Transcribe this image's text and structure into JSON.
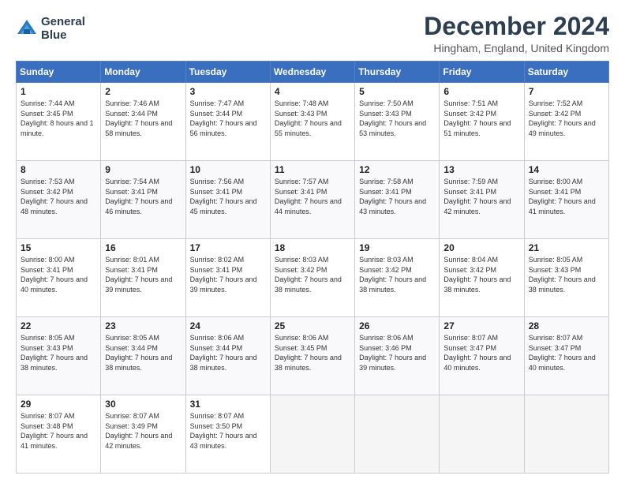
{
  "logo": {
    "line1": "General",
    "line2": "Blue"
  },
  "title": "December 2024",
  "subtitle": "Hingham, England, United Kingdom",
  "headers": [
    "Sunday",
    "Monday",
    "Tuesday",
    "Wednesday",
    "Thursday",
    "Friday",
    "Saturday"
  ],
  "weeks": [
    [
      {
        "day": "1",
        "rise": "Sunrise: 7:44 AM",
        "set": "Sunset: 3:45 PM",
        "daylight": "Daylight: 8 hours and 1 minute."
      },
      {
        "day": "2",
        "rise": "Sunrise: 7:46 AM",
        "set": "Sunset: 3:44 PM",
        "daylight": "Daylight: 7 hours and 58 minutes."
      },
      {
        "day": "3",
        "rise": "Sunrise: 7:47 AM",
        "set": "Sunset: 3:44 PM",
        "daylight": "Daylight: 7 hours and 56 minutes."
      },
      {
        "day": "4",
        "rise": "Sunrise: 7:48 AM",
        "set": "Sunset: 3:43 PM",
        "daylight": "Daylight: 7 hours and 55 minutes."
      },
      {
        "day": "5",
        "rise": "Sunrise: 7:50 AM",
        "set": "Sunset: 3:43 PM",
        "daylight": "Daylight: 7 hours and 53 minutes."
      },
      {
        "day": "6",
        "rise": "Sunrise: 7:51 AM",
        "set": "Sunset: 3:42 PM",
        "daylight": "Daylight: 7 hours and 51 minutes."
      },
      {
        "day": "7",
        "rise": "Sunrise: 7:52 AM",
        "set": "Sunset: 3:42 PM",
        "daylight": "Daylight: 7 hours and 49 minutes."
      }
    ],
    [
      {
        "day": "8",
        "rise": "Sunrise: 7:53 AM",
        "set": "Sunset: 3:42 PM",
        "daylight": "Daylight: 7 hours and 48 minutes."
      },
      {
        "day": "9",
        "rise": "Sunrise: 7:54 AM",
        "set": "Sunset: 3:41 PM",
        "daylight": "Daylight: 7 hours and 46 minutes."
      },
      {
        "day": "10",
        "rise": "Sunrise: 7:56 AM",
        "set": "Sunset: 3:41 PM",
        "daylight": "Daylight: 7 hours and 45 minutes."
      },
      {
        "day": "11",
        "rise": "Sunrise: 7:57 AM",
        "set": "Sunset: 3:41 PM",
        "daylight": "Daylight: 7 hours and 44 minutes."
      },
      {
        "day": "12",
        "rise": "Sunrise: 7:58 AM",
        "set": "Sunset: 3:41 PM",
        "daylight": "Daylight: 7 hours and 43 minutes."
      },
      {
        "day": "13",
        "rise": "Sunrise: 7:59 AM",
        "set": "Sunset: 3:41 PM",
        "daylight": "Daylight: 7 hours and 42 minutes."
      },
      {
        "day": "14",
        "rise": "Sunrise: 8:00 AM",
        "set": "Sunset: 3:41 PM",
        "daylight": "Daylight: 7 hours and 41 minutes."
      }
    ],
    [
      {
        "day": "15",
        "rise": "Sunrise: 8:00 AM",
        "set": "Sunset: 3:41 PM",
        "daylight": "Daylight: 7 hours and 40 minutes."
      },
      {
        "day": "16",
        "rise": "Sunrise: 8:01 AM",
        "set": "Sunset: 3:41 PM",
        "daylight": "Daylight: 7 hours and 39 minutes."
      },
      {
        "day": "17",
        "rise": "Sunrise: 8:02 AM",
        "set": "Sunset: 3:41 PM",
        "daylight": "Daylight: 7 hours and 39 minutes."
      },
      {
        "day": "18",
        "rise": "Sunrise: 8:03 AM",
        "set": "Sunset: 3:42 PM",
        "daylight": "Daylight: 7 hours and 38 minutes."
      },
      {
        "day": "19",
        "rise": "Sunrise: 8:03 AM",
        "set": "Sunset: 3:42 PM",
        "daylight": "Daylight: 7 hours and 38 minutes."
      },
      {
        "day": "20",
        "rise": "Sunrise: 8:04 AM",
        "set": "Sunset: 3:42 PM",
        "daylight": "Daylight: 7 hours and 38 minutes."
      },
      {
        "day": "21",
        "rise": "Sunrise: 8:05 AM",
        "set": "Sunset: 3:43 PM",
        "daylight": "Daylight: 7 hours and 38 minutes."
      }
    ],
    [
      {
        "day": "22",
        "rise": "Sunrise: 8:05 AM",
        "set": "Sunset: 3:43 PM",
        "daylight": "Daylight: 7 hours and 38 minutes."
      },
      {
        "day": "23",
        "rise": "Sunrise: 8:05 AM",
        "set": "Sunset: 3:44 PM",
        "daylight": "Daylight: 7 hours and 38 minutes."
      },
      {
        "day": "24",
        "rise": "Sunrise: 8:06 AM",
        "set": "Sunset: 3:44 PM",
        "daylight": "Daylight: 7 hours and 38 minutes."
      },
      {
        "day": "25",
        "rise": "Sunrise: 8:06 AM",
        "set": "Sunset: 3:45 PM",
        "daylight": "Daylight: 7 hours and 38 minutes."
      },
      {
        "day": "26",
        "rise": "Sunrise: 8:06 AM",
        "set": "Sunset: 3:46 PM",
        "daylight": "Daylight: 7 hours and 39 minutes."
      },
      {
        "day": "27",
        "rise": "Sunrise: 8:07 AM",
        "set": "Sunset: 3:47 PM",
        "daylight": "Daylight: 7 hours and 40 minutes."
      },
      {
        "day": "28",
        "rise": "Sunrise: 8:07 AM",
        "set": "Sunset: 3:47 PM",
        "daylight": "Daylight: 7 hours and 40 minutes."
      }
    ],
    [
      {
        "day": "29",
        "rise": "Sunrise: 8:07 AM",
        "set": "Sunset: 3:48 PM",
        "daylight": "Daylight: 7 hours and 41 minutes."
      },
      {
        "day": "30",
        "rise": "Sunrise: 8:07 AM",
        "set": "Sunset: 3:49 PM",
        "daylight": "Daylight: 7 hours and 42 minutes."
      },
      {
        "day": "31",
        "rise": "Sunrise: 8:07 AM",
        "set": "Sunset: 3:50 PM",
        "daylight": "Daylight: 7 hours and 43 minutes."
      },
      null,
      null,
      null,
      null
    ]
  ]
}
